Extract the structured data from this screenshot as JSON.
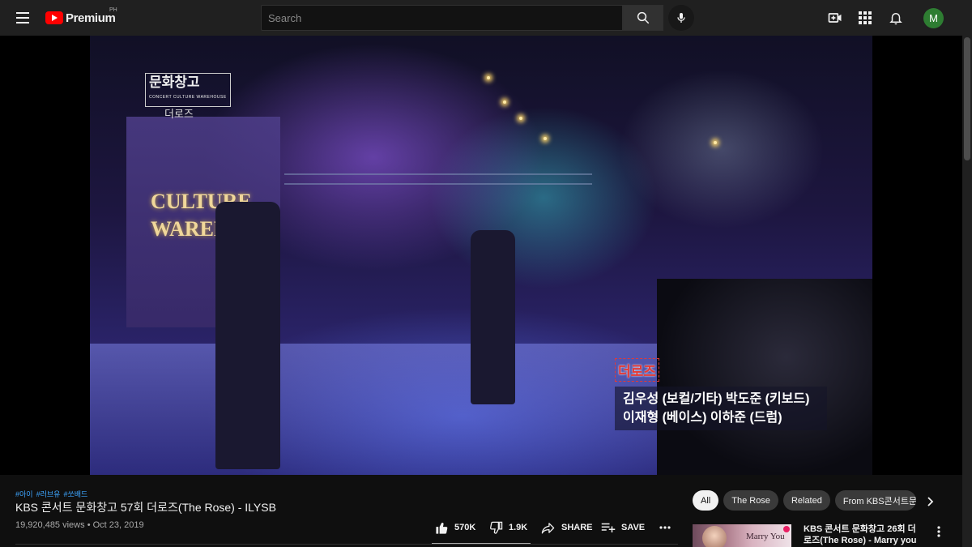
{
  "header": {
    "logo_text": "Premium",
    "region": "PH",
    "search_placeholder": "Search",
    "avatar_letter": "M",
    "avatar_color": "#2e7d32",
    "icons": [
      "menu-icon",
      "search-icon",
      "mic-icon",
      "create-video-icon",
      "apps-grid-icon",
      "notifications-bell-icon"
    ]
  },
  "video": {
    "overlay_logo": "문화창고",
    "overlay_logo_small": "CONCERT CULTURE WAREHOUSE",
    "overlay_logo_sub": "더로즈",
    "stage_sign": [
      "CULTURE",
      "WAREHO"
    ],
    "caption": {
      "name": "더로즈",
      "line1": "김우성 (보컬/기타) 박도준 (키보드)",
      "line2": "이재형 (베이스) 이하준 (드럼)"
    }
  },
  "info": {
    "hashtags": [
      "#아이",
      "#러브유",
      "#쏘배드"
    ],
    "title": "KBS 콘서트 문화창고 57회 더로즈(The Rose) - ILYSB",
    "views": "19,920,485 views",
    "separator": "•",
    "date": "Oct 23, 2019",
    "likes": "570K",
    "dislikes": "1.9K",
    "share_label": "SHARE",
    "save_label": "SAVE"
  },
  "chips": [
    "All",
    "The Rose",
    "Related",
    "From KBS콘서트문화창고"
  ],
  "recommended": {
    "thumb_text": "Marry You",
    "title": "KBS 콘서트 문화창고 26회 더 로즈(The Rose) - Marry you"
  },
  "colors": {
    "brand_red": "#ff0000",
    "link_blue": "#3ea6ff",
    "caption_red": "#e53935"
  }
}
